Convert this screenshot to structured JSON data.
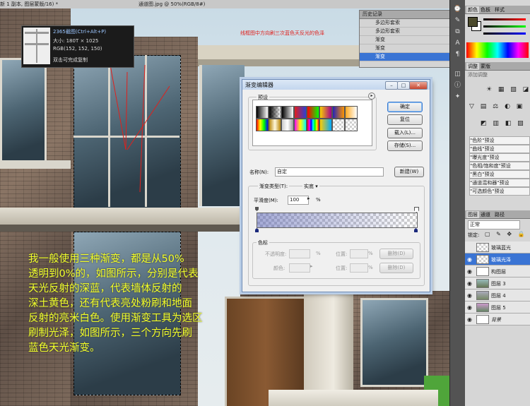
{
  "tabstrip": {
    "tab1": "新 1 副本, 图层蒙版/16) *",
    "tab2": "通道图.jpg @ 50%(RGB/8#)"
  },
  "info_tooltip": {
    "line1": "2365截图(Ctrl+Alt+P)",
    "line2": "大小: 180T × 1025",
    "line3": "RGB(152, 152, 150)",
    "line4": "双击可完成复制"
  },
  "annotation_red": "线框图中方向刷三次蓝色天反光的色泽",
  "yellow_text": [
    "我一般使用三种渐变，都是从50%",
    "透明到0%的，如图所示，分别是代表",
    "天光反射的深蓝，代表墙体反射的",
    "深土黄色，还有代表亮处粉刷和地面",
    "反射的亮米白色。使用渐变工具为选区",
    "刷制光泽，如图所示，三个方向先刷",
    "蓝色天光渐变。"
  ],
  "history_panel": {
    "title": "历史记录",
    "items": [
      {
        "label": "多边形套索",
        "selected": false
      },
      {
        "label": "多边形套索",
        "selected": false
      },
      {
        "label": "渐变",
        "selected": false
      },
      {
        "label": "渐变",
        "selected": false
      },
      {
        "label": "渐变",
        "selected": true
      }
    ]
  },
  "color_panel": {
    "tabs": [
      "颜色",
      "色板",
      "样式"
    ],
    "foreground": "#4b4a2c",
    "background": "#ffffff"
  },
  "adjust_panel": {
    "tabs": [
      "调整",
      "蒙版"
    ],
    "subtitle": "添加调整",
    "presets": [
      "\"色阶\"预设",
      "\"曲线\"预设",
      "\"曝光度\"预设",
      "\"色相/饱和度\"预设",
      "\"黑白\"预设",
      "\"通道混和器\"预设",
      "\"可选颜色\"预设"
    ]
  },
  "layers_panel": {
    "tabs": [
      "图层",
      "通道",
      "路径"
    ],
    "blend_mode": "正常",
    "lock_label": "锁定:",
    "layers": [
      {
        "name": "玻璃蓝光",
        "visible": false,
        "selected": false,
        "italic": false
      },
      {
        "name": "玻璃光泽",
        "visible": true,
        "selected": true,
        "italic": false
      },
      {
        "name": "构图层",
        "visible": true,
        "selected": false,
        "italic": false
      },
      {
        "name": "图层 3",
        "visible": true,
        "selected": false,
        "italic": false
      },
      {
        "name": "图层 4",
        "visible": true,
        "selected": false,
        "italic": false
      },
      {
        "name": "图层 5",
        "visible": true,
        "selected": false,
        "italic": false
      },
      {
        "name": "背景",
        "visible": true,
        "selected": false,
        "italic": true
      }
    ]
  },
  "gradient_editor": {
    "title": "渐变编辑器",
    "presets_label": "预设",
    "ok_button": "确定",
    "reset_button": "复位",
    "load_button": "载入(L)...",
    "save_button": "存储(S)...",
    "name_label": "名称(N):",
    "name_value": "自定",
    "new_button": "新建(W)",
    "type_label": "渐变类型(T):",
    "type_value": "实底",
    "smoothness_label": "平滑度(M):",
    "smoothness_value": "100",
    "percent": "%",
    "stops_group": "色标",
    "opacity_label": "不透明度:",
    "location_label": "位置:",
    "delete_label": "删除(D)",
    "color_label": "颜色:",
    "location_label2": "位置:",
    "delete_label2": "删除(D)",
    "percent2": "%",
    "percent3": "%",
    "percent4": "%",
    "gradient_color": "#5a64b4",
    "stop_opacity_start": 50,
    "stop_opacity_end": 0
  }
}
